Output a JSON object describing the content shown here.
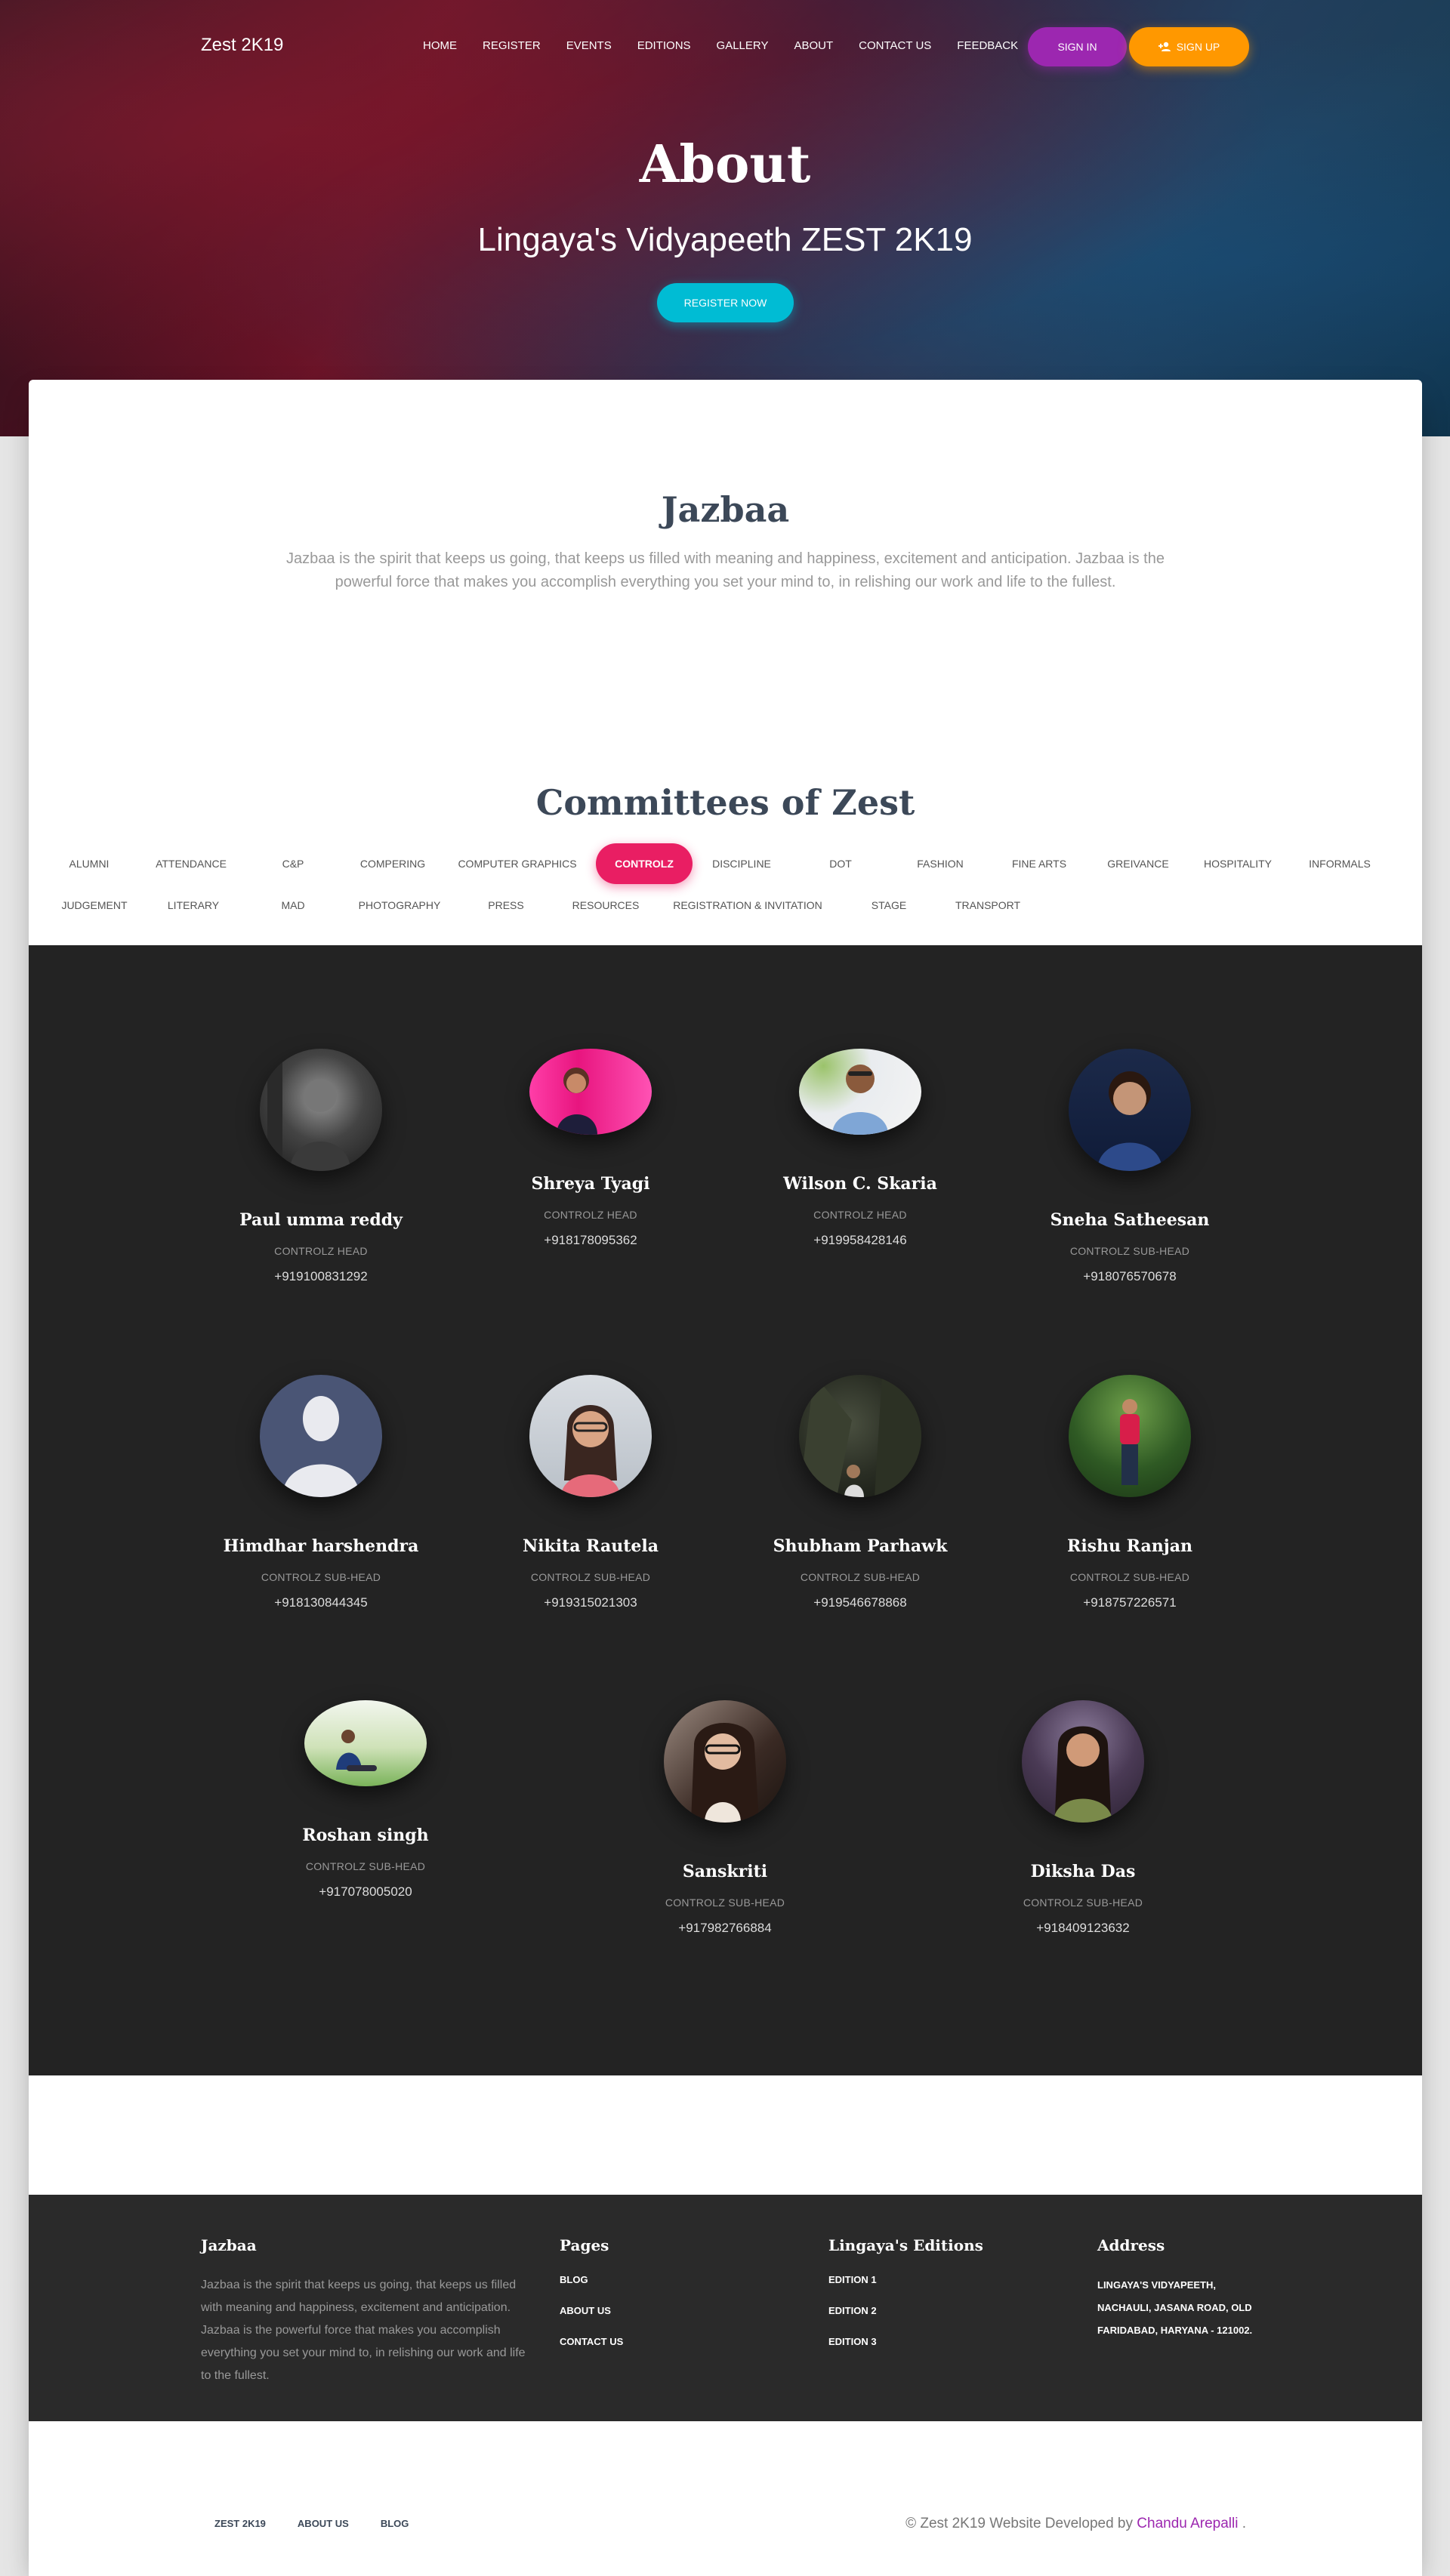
{
  "navbar": {
    "brand": "Zest 2K19",
    "links": [
      "HOME",
      "REGISTER",
      "EVENTS",
      "EDITIONS",
      "GALLERY",
      "ABOUT",
      "CONTACT US",
      "FEEDBACK"
    ],
    "signin": "SIGN IN",
    "signup": "SIGN UP"
  },
  "hero": {
    "title": "About",
    "subtitle": "Lingaya's Vidyapeeth ZEST 2K19",
    "register": "REGISTER NOW"
  },
  "about": {
    "title": "Jazbaa",
    "description": "Jazbaa is the spirit that keeps us going, that keeps us filled with meaning and happiness, excitement and anticipation. Jazbaa is the powerful force that makes you accomplish everything you set your mind to, in relishing our work and life to the fullest."
  },
  "committees": {
    "title": "Committees of Zest",
    "active": "CONTROLZ",
    "row1": [
      "ALUMNI",
      "ATTENDANCE",
      "C&P",
      "COMPERING",
      "COMPUTER GRAPHICS",
      "CONTROLZ",
      "DISCIPLINE",
      "DOT",
      "FASHION",
      "FINE ARTS",
      "GREIVANCE",
      "HOSPITALITY",
      "INFORMALS"
    ],
    "row2": [
      "JUDGEMENT",
      "LITERARY",
      "MAD",
      "PHOTOGRAPHY",
      "PRESS",
      "RESOURCES",
      "REGISTRATION & INVITATION",
      "STAGE",
      "TRANSPORT"
    ]
  },
  "members": [
    {
      "name": "Paul umma reddy",
      "role": "CONTROLZ HEAD",
      "phone": "+919100831292"
    },
    {
      "name": "Shreya Tyagi",
      "role": "CONTROLZ HEAD",
      "phone": "+918178095362"
    },
    {
      "name": "Wilson C. Skaria",
      "role": "CONTROLZ HEAD",
      "phone": "+919958428146"
    },
    {
      "name": "Sneha Satheesan",
      "role": "CONTROLZ SUB-HEAD",
      "phone": "+918076570678"
    },
    {
      "name": "Himdhar harshendra",
      "role": "CONTROLZ SUB-HEAD",
      "phone": "+918130844345"
    },
    {
      "name": "Nikita Rautela",
      "role": "CONTROLZ SUB-HEAD",
      "phone": "+919315021303"
    },
    {
      "name": "Shubham Parhawk",
      "role": "CONTROLZ SUB-HEAD",
      "phone": "+919546678868"
    },
    {
      "name": "Rishu Ranjan",
      "role": "CONTROLZ SUB-HEAD",
      "phone": "+918757226571"
    },
    {
      "name": "Roshan singh",
      "role": "CONTROLZ SUB-HEAD",
      "phone": "+917078005020"
    },
    {
      "name": "Sanskriti",
      "role": "CONTROLZ SUB-HEAD",
      "phone": "+917982766884"
    },
    {
      "name": "Diksha Das",
      "role": "CONTROLZ SUB-HEAD",
      "phone": "+918409123632"
    }
  ],
  "footer": {
    "about_title": "Jazbaa",
    "about_text": "Jazbaa is the spirit that keeps us going, that keeps us filled with meaning and happiness, excitement and anticipation. Jazbaa is the powerful force that makes you accomplish everything you set your mind to, in relishing our work and life to the fullest.",
    "pages_title": "Pages",
    "pages": [
      "BLOG",
      "ABOUT US",
      "CONTACT US"
    ],
    "editions_title": "Lingaya's Editions",
    "editions": [
      "EDITION 1",
      "EDITION 2",
      "EDITION 3"
    ],
    "address_title": "Address",
    "address": "LINGAYA'S VIDYAPEETH, NACHAULI, JASANA ROAD, OLD FARIDABAD, HARYANA - 121002.",
    "bottom_links": [
      "ZEST 2K19",
      "ABOUT US",
      "BLOG"
    ],
    "copyright_prefix": "© Zest 2K19 Website Developed by",
    "copyright_author": "Chandu Arepalli",
    "copyright_suffix": "."
  }
}
